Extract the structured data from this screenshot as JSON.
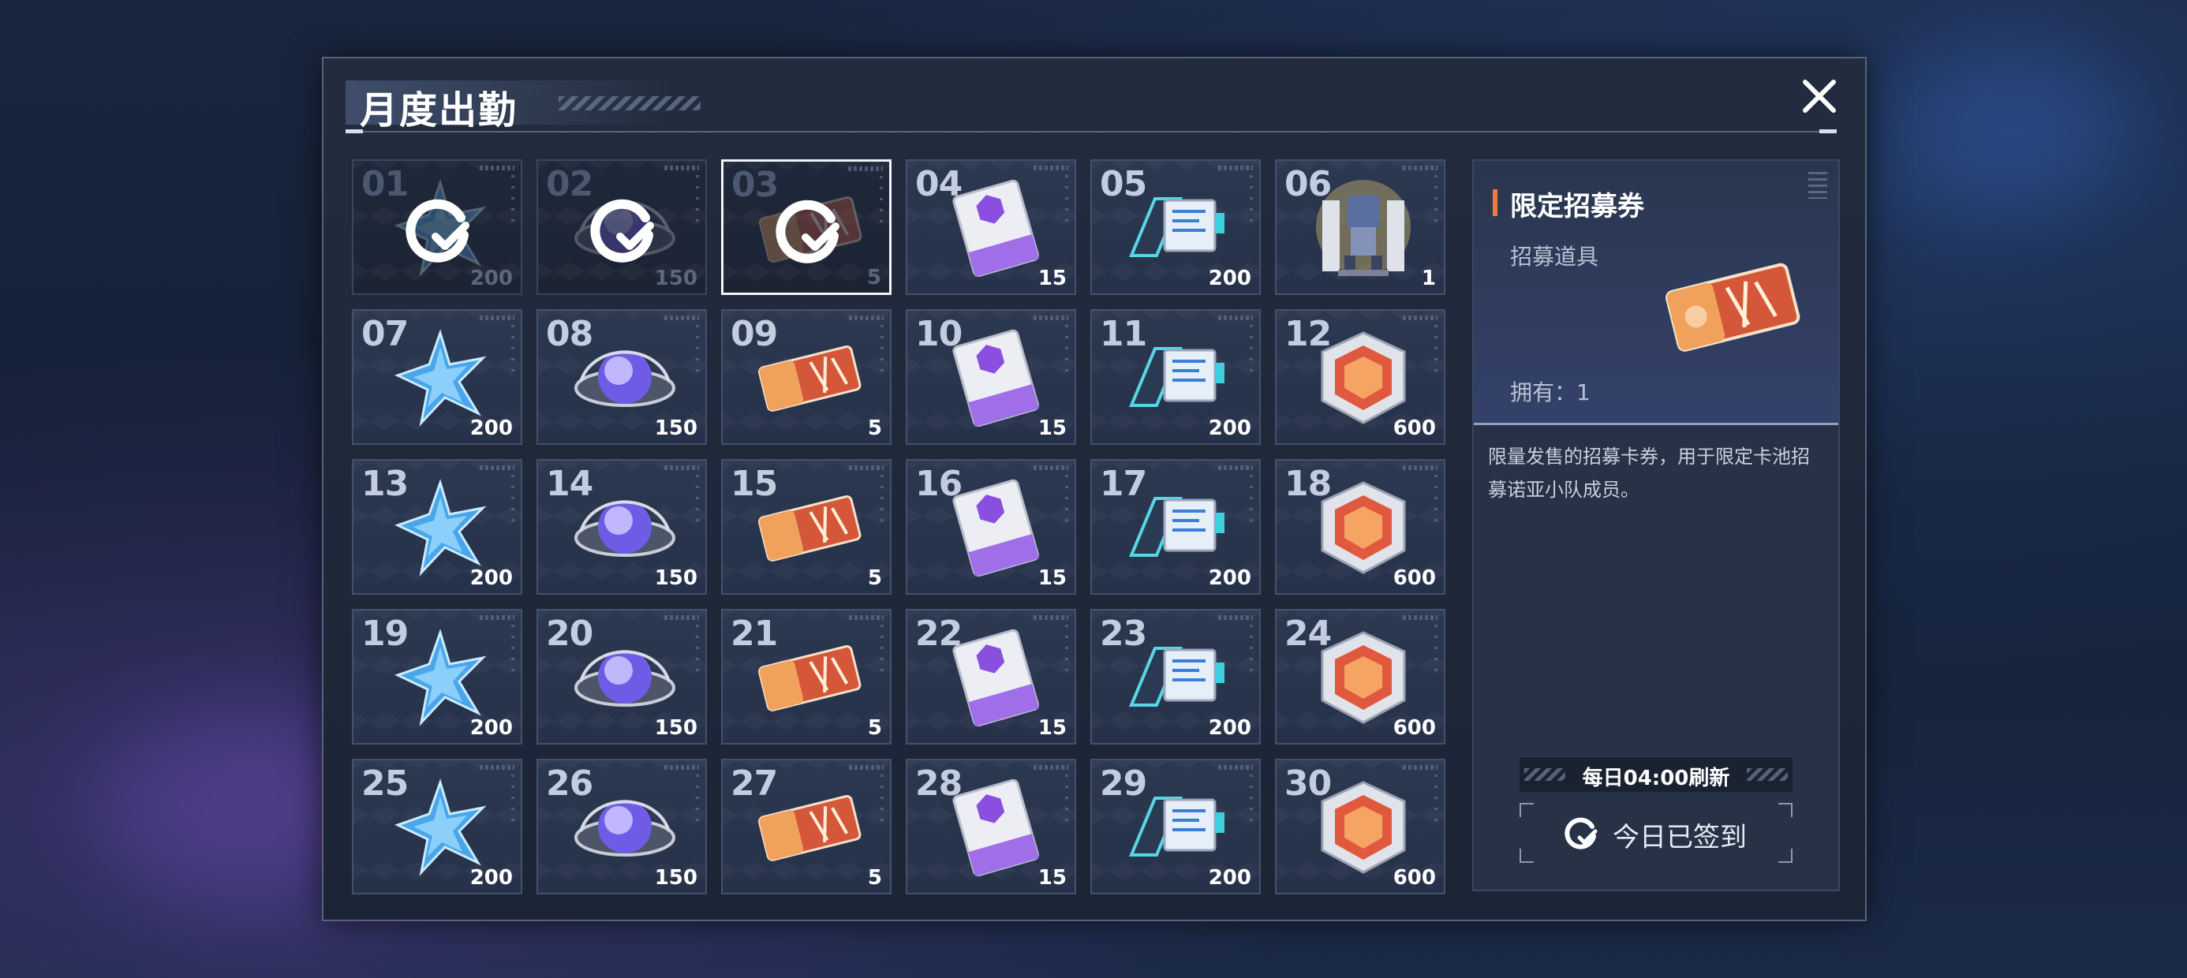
{
  "modal": {
    "title": "月度出勤"
  },
  "days": [
    {
      "day": "01",
      "qty": "200",
      "item": "star-crystal-icon",
      "claimed": true
    },
    {
      "day": "02",
      "qty": "150",
      "item": "orb-icon",
      "claimed": true
    },
    {
      "day": "03",
      "qty": "5",
      "item": "recruit-ticket-icon",
      "claimed": true,
      "selected": true
    },
    {
      "day": "04",
      "qty": "15",
      "item": "purple-chip-card-icon",
      "claimed": false
    },
    {
      "day": "05",
      "qty": "200",
      "item": "data-module-icon",
      "claimed": false
    },
    {
      "day": "06",
      "qty": "1",
      "item": "mech-figure-icon",
      "claimed": false
    },
    {
      "day": "07",
      "qty": "200",
      "item": "star-crystal-icon",
      "claimed": false
    },
    {
      "day": "08",
      "qty": "150",
      "item": "orb-icon",
      "claimed": false
    },
    {
      "day": "09",
      "qty": "5",
      "item": "recruit-ticket-icon",
      "claimed": false
    },
    {
      "day": "10",
      "qty": "15",
      "item": "purple-chip-card-icon",
      "claimed": false
    },
    {
      "day": "11",
      "qty": "200",
      "item": "data-module-icon",
      "claimed": false
    },
    {
      "day": "12",
      "qty": "600",
      "item": "cube-box-icon",
      "claimed": false
    },
    {
      "day": "13",
      "qty": "200",
      "item": "star-crystal-icon",
      "claimed": false
    },
    {
      "day": "14",
      "qty": "150",
      "item": "orb-icon",
      "claimed": false
    },
    {
      "day": "15",
      "qty": "5",
      "item": "recruit-ticket-icon",
      "claimed": false
    },
    {
      "day": "16",
      "qty": "15",
      "item": "purple-chip-card-icon",
      "claimed": false
    },
    {
      "day": "17",
      "qty": "200",
      "item": "data-module-icon",
      "claimed": false
    },
    {
      "day": "18",
      "qty": "600",
      "item": "cube-box-icon",
      "claimed": false
    },
    {
      "day": "19",
      "qty": "200",
      "item": "star-crystal-icon",
      "claimed": false
    },
    {
      "day": "20",
      "qty": "150",
      "item": "orb-icon",
      "claimed": false
    },
    {
      "day": "21",
      "qty": "5",
      "item": "recruit-ticket-icon",
      "claimed": false
    },
    {
      "day": "22",
      "qty": "15",
      "item": "purple-chip-card-icon",
      "claimed": false
    },
    {
      "day": "23",
      "qty": "200",
      "item": "data-module-icon",
      "claimed": false
    },
    {
      "day": "24",
      "qty": "600",
      "item": "cube-box-icon",
      "claimed": false
    },
    {
      "day": "25",
      "qty": "200",
      "item": "star-crystal-icon",
      "claimed": false
    },
    {
      "day": "26",
      "qty": "150",
      "item": "orb-icon",
      "claimed": false
    },
    {
      "day": "27",
      "qty": "5",
      "item": "recruit-ticket-icon",
      "claimed": false
    },
    {
      "day": "28",
      "qty": "15",
      "item": "purple-chip-card-icon",
      "claimed": false
    },
    {
      "day": "29",
      "qty": "200",
      "item": "data-module-icon",
      "claimed": false
    },
    {
      "day": "30",
      "qty": "600",
      "item": "cube-box-icon",
      "claimed": false
    }
  ],
  "detail": {
    "name": "限定招募券",
    "type": "招募道具",
    "owned": "拥有：1",
    "description": "限量发售的招募卡券，用于限定卡池招募诺亚小队成员。",
    "refresh": "每日04:00刷新",
    "signed_label": "今日已签到",
    "accent_color": "#f07b3f"
  }
}
